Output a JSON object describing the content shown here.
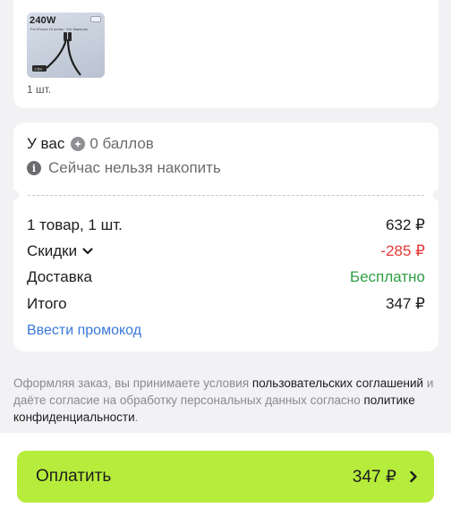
{
  "product": {
    "image_badge": "240W",
    "image_subtext": "For iPhone 15 series · For Macbook",
    "quantity": "1 шт."
  },
  "points": {
    "label": "У вас",
    "balance": "0 баллов",
    "info_text": "Сейчас нельзя накопить"
  },
  "summary": {
    "items_label": "1 товар, 1 шт.",
    "items_value": "632 ₽",
    "discounts_label": "Скидки",
    "discounts_value": "-285 ₽",
    "delivery_label": "Доставка",
    "delivery_value": "Бесплатно",
    "total_label": "Итого",
    "total_value": "347 ₽",
    "promo_link": "Ввести промокод"
  },
  "legal": {
    "part1": "Оформляя заказ, вы принимаете условия ",
    "link1": "пользовательских соглашений",
    "part2": " и даёте согласие на обработку персональных данных согласно ",
    "link2": "политике конфиденциальности",
    "part3": "."
  },
  "pay_button": {
    "label": "Оплатить",
    "amount": "347 ₽"
  },
  "colors": {
    "pay_button_bg": "#b6ec3b",
    "discount": "#e53935",
    "free_delivery": "#2e9e45",
    "link": "#3a78d8"
  }
}
